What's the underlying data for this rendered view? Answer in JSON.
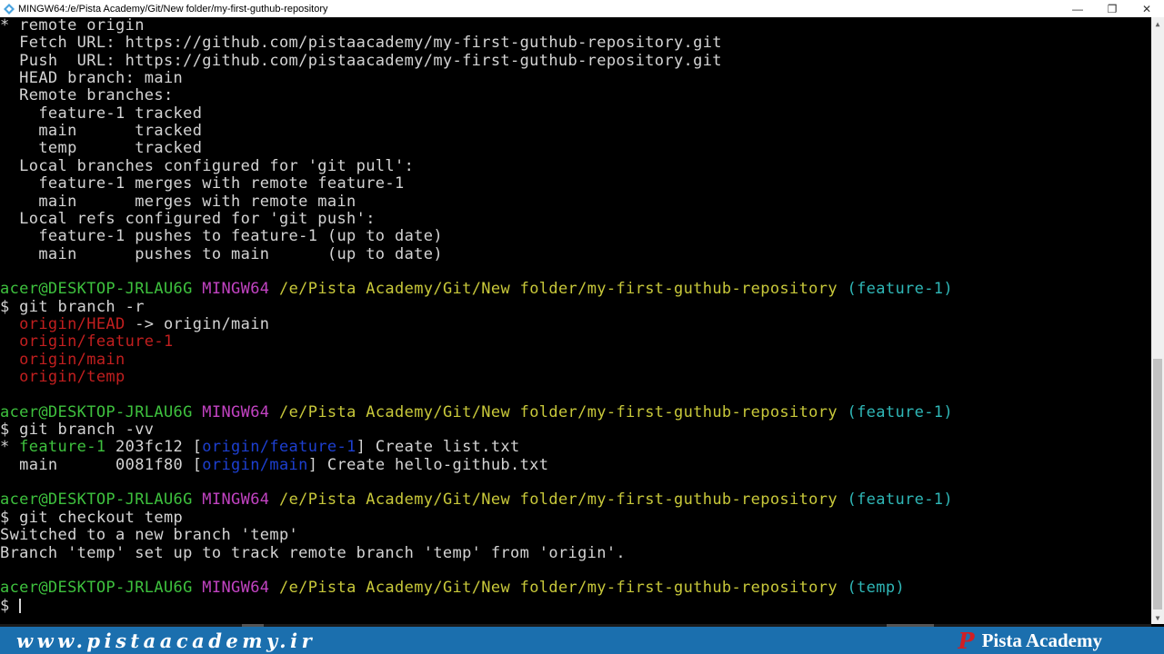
{
  "window": {
    "title": "MINGW64:/e/Pista Academy/Git/New folder/my-first-guthub-repository",
    "minimize_glyph": "—",
    "maximize_glyph": "❐",
    "close_glyph": "✕"
  },
  "terminal": {
    "lines": [
      [
        {
          "t": "* remote origin",
          "c": "c-text"
        }
      ],
      [
        {
          "t": "  Fetch URL: https://github.com/pistaacademy/my-first-guthub-repository.git",
          "c": "c-text"
        }
      ],
      [
        {
          "t": "  Push  URL: https://github.com/pistaacademy/my-first-guthub-repository.git",
          "c": "c-text"
        }
      ],
      [
        {
          "t": "  HEAD branch: main",
          "c": "c-text"
        }
      ],
      [
        {
          "t": "  Remote branches:",
          "c": "c-text"
        }
      ],
      [
        {
          "t": "    feature-1 tracked",
          "c": "c-text"
        }
      ],
      [
        {
          "t": "    main      tracked",
          "c": "c-text"
        }
      ],
      [
        {
          "t": "    temp      tracked",
          "c": "c-text"
        }
      ],
      [
        {
          "t": "  Local branches configured for 'git pull':",
          "c": "c-text"
        }
      ],
      [
        {
          "t": "    feature-1 merges with remote feature-1",
          "c": "c-text"
        }
      ],
      [
        {
          "t": "    main      merges with remote main",
          "c": "c-text"
        }
      ],
      [
        {
          "t": "  Local refs configured for 'git push':",
          "c": "c-text"
        }
      ],
      [
        {
          "t": "    feature-1 pushes to feature-1 (up to date)",
          "c": "c-text"
        }
      ],
      [
        {
          "t": "    main      pushes to main      (up to date)",
          "c": "c-text"
        }
      ],
      [],
      [
        {
          "t": "acer@DESKTOP-JRLAU6G",
          "c": "c-user"
        },
        {
          "t": " ",
          "c": "c-text"
        },
        {
          "t": "MINGW64",
          "c": "c-mingw"
        },
        {
          "t": " ",
          "c": "c-text"
        },
        {
          "t": "/e/Pista Academy/Git/New folder/my-first-guthub-repository",
          "c": "c-path"
        },
        {
          "t": " ",
          "c": "c-text"
        },
        {
          "t": "(feature-1)",
          "c": "c-branch"
        }
      ],
      [
        {
          "t": "$ git branch -r",
          "c": "c-text"
        }
      ],
      [
        {
          "t": "  ",
          "c": "c-text"
        },
        {
          "t": "origin/HEAD",
          "c": "c-red"
        },
        {
          "t": " -> origin/main",
          "c": "c-text"
        }
      ],
      [
        {
          "t": "  ",
          "c": "c-text"
        },
        {
          "t": "origin/feature-1",
          "c": "c-red"
        }
      ],
      [
        {
          "t": "  ",
          "c": "c-text"
        },
        {
          "t": "origin/main",
          "c": "c-red"
        }
      ],
      [
        {
          "t": "  ",
          "c": "c-text"
        },
        {
          "t": "origin/temp",
          "c": "c-red"
        }
      ],
      [],
      [
        {
          "t": "acer@DESKTOP-JRLAU6G",
          "c": "c-user"
        },
        {
          "t": " ",
          "c": "c-text"
        },
        {
          "t": "MINGW64",
          "c": "c-mingw"
        },
        {
          "t": " ",
          "c": "c-text"
        },
        {
          "t": "/e/Pista Academy/Git/New folder/my-first-guthub-repository",
          "c": "c-path"
        },
        {
          "t": " ",
          "c": "c-text"
        },
        {
          "t": "(feature-1)",
          "c": "c-branch"
        }
      ],
      [
        {
          "t": "$ git branch -vv",
          "c": "c-text"
        }
      ],
      [
        {
          "t": "* ",
          "c": "c-text"
        },
        {
          "t": "feature-1",
          "c": "c-green"
        },
        {
          "t": " 203fc12 [",
          "c": "c-text"
        },
        {
          "t": "origin/feature-1",
          "c": "c-blue"
        },
        {
          "t": "] Create list.txt",
          "c": "c-text"
        }
      ],
      [
        {
          "t": "  main      0081f80 [",
          "c": "c-text"
        },
        {
          "t": "origin/main",
          "c": "c-blue"
        },
        {
          "t": "] Create hello-github.txt",
          "c": "c-text"
        }
      ],
      [],
      [
        {
          "t": "acer@DESKTOP-JRLAU6G",
          "c": "c-user"
        },
        {
          "t": " ",
          "c": "c-text"
        },
        {
          "t": "MINGW64",
          "c": "c-mingw"
        },
        {
          "t": " ",
          "c": "c-text"
        },
        {
          "t": "/e/Pista Academy/Git/New folder/my-first-guthub-repository",
          "c": "c-path"
        },
        {
          "t": " ",
          "c": "c-text"
        },
        {
          "t": "(feature-1)",
          "c": "c-branch"
        }
      ],
      [
        {
          "t": "$ git checkout temp",
          "c": "c-text"
        }
      ],
      [
        {
          "t": "Switched to a new branch 'temp'",
          "c": "c-text"
        }
      ],
      [
        {
          "t": "Branch 'temp' set up to track remote branch 'temp' from 'origin'.",
          "c": "c-text"
        }
      ],
      [],
      [
        {
          "t": "acer@DESKTOP-JRLAU6G",
          "c": "c-user"
        },
        {
          "t": " ",
          "c": "c-text"
        },
        {
          "t": "MINGW64",
          "c": "c-mingw"
        },
        {
          "t": " ",
          "c": "c-text"
        },
        {
          "t": "/e/Pista Academy/Git/New folder/my-first-guthub-repository",
          "c": "c-path"
        },
        {
          "t": " ",
          "c": "c-text"
        },
        {
          "t": "(temp)",
          "c": "c-branch"
        }
      ],
      [
        {
          "t": "$ ",
          "c": "c-text"
        }
      ]
    ]
  },
  "banner": {
    "website": "www.pistaacademy.ir",
    "logo_glyph": "P",
    "brand_name": "Pista Academy"
  }
}
